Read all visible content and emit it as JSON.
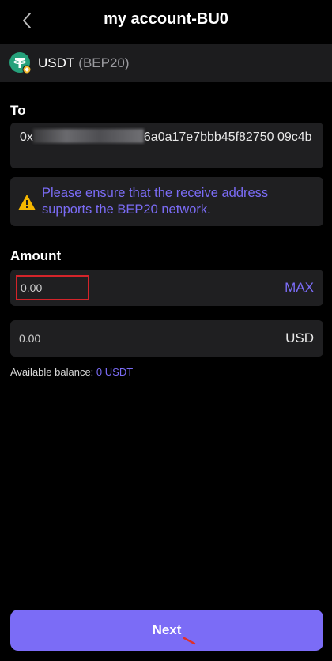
{
  "header": {
    "title": "my account-BU0",
    "back_icon": "chevron-left-icon"
  },
  "token": {
    "symbol": "USDT",
    "network": "(BEP20)",
    "icon": "tether-icon",
    "brand_color": "#26a17b"
  },
  "to_section": {
    "label": "To",
    "address_start": "0x",
    "address_end": "6a0a17e7bbb45f82750 09c4b"
  },
  "warning": {
    "icon": "warning-triangle-icon",
    "text": "Please ensure that the receive address supports the BEP20 network."
  },
  "amount_section": {
    "label": "Amount",
    "amount_placeholder": "0.00",
    "max_label": "MAX",
    "usd_placeholder": "0.00",
    "usd_unit": "USD"
  },
  "balance": {
    "label": "Available balance:",
    "value": "0 USDT"
  },
  "next_button": {
    "label": "Next"
  },
  "colors": {
    "accent": "#7b6cf6",
    "background": "#000000",
    "field": "#1f1f21",
    "highlight": "#d4242a"
  }
}
